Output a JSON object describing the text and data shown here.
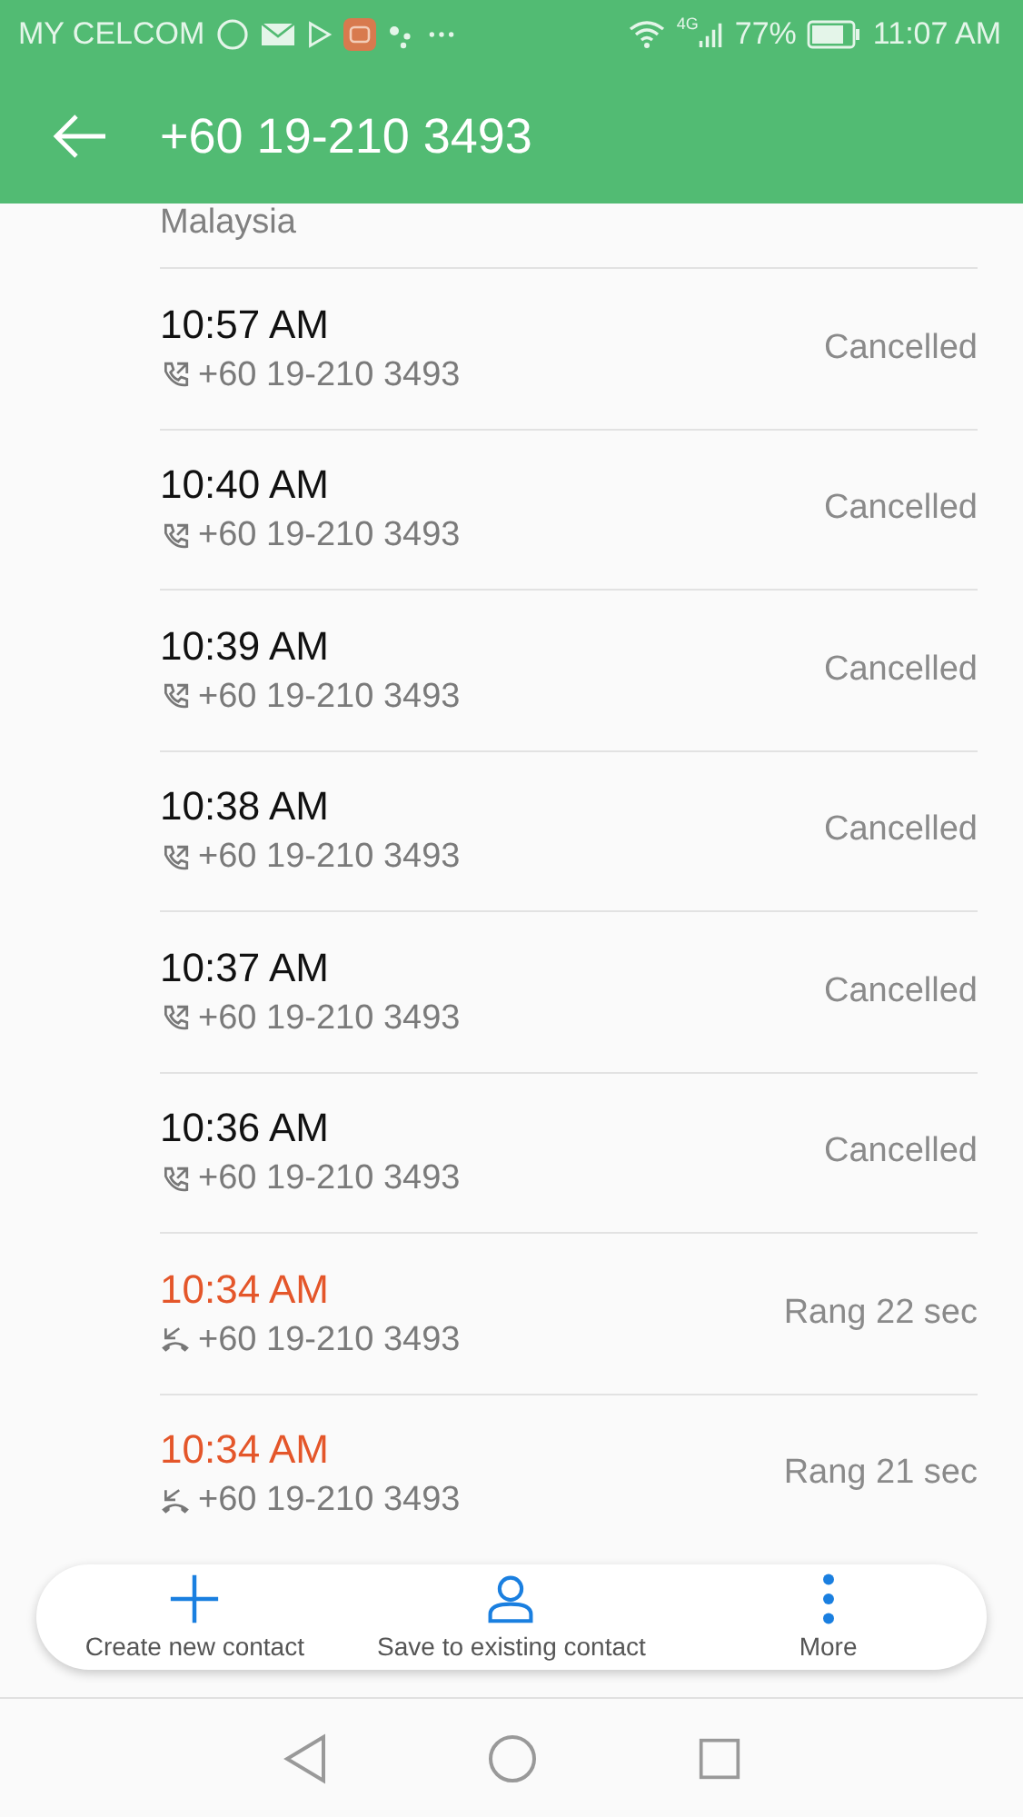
{
  "status_bar": {
    "carrier": "MY CELCOM",
    "battery": "77%",
    "network": "4G",
    "time": "11:07 AM"
  },
  "app_bar": {
    "title": "+60 19-210 3493"
  },
  "location": "Malaysia",
  "calls": [
    {
      "kind": "outgoing",
      "time": "10:57 AM",
      "number": "+60 19-210 3493",
      "result": "Cancelled"
    },
    {
      "kind": "outgoing",
      "time": "10:40 AM",
      "number": "+60 19-210 3493",
      "result": "Cancelled"
    },
    {
      "kind": "outgoing",
      "time": "10:39 AM",
      "number": "+60 19-210 3493",
      "result": "Cancelled"
    },
    {
      "kind": "outgoing",
      "time": "10:38 AM",
      "number": "+60 19-210 3493",
      "result": "Cancelled"
    },
    {
      "kind": "outgoing",
      "time": "10:37 AM",
      "number": "+60 19-210 3493",
      "result": "Cancelled"
    },
    {
      "kind": "outgoing",
      "time": "10:36 AM",
      "number": "+60 19-210 3493",
      "result": "Cancelled"
    },
    {
      "kind": "missed",
      "time": "10:34 AM",
      "number": "+60 19-210 3493",
      "result": "Rang 22 sec"
    },
    {
      "kind": "missed",
      "time": "10:34 AM",
      "number": "+60 19-210 3493",
      "result": "Rang 21 sec"
    }
  ],
  "actions": [
    {
      "kind": "add",
      "label": "Create new contact"
    },
    {
      "kind": "person",
      "label": "Save to existing contact"
    },
    {
      "kind": "more",
      "label": "More"
    }
  ]
}
